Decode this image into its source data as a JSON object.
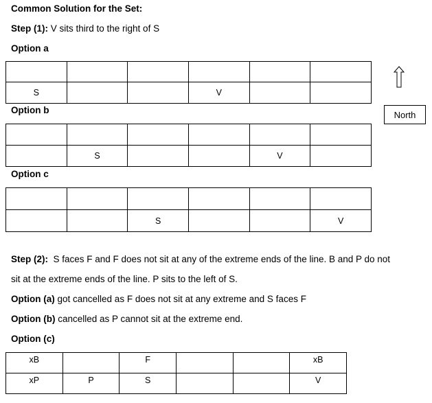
{
  "heading": "Common Solution for the Set:",
  "step1": {
    "label": "Step (1):",
    "text": " V sits third to the right of S"
  },
  "option_a": {
    "label": "Option a",
    "rows": [
      [
        "",
        "",
        "",
        "",
        "",
        ""
      ],
      [
        "S",
        "",
        "",
        "V",
        "",
        ""
      ]
    ]
  },
  "option_b": {
    "label": "Option b",
    "rows": [
      [
        "",
        "",
        "",
        "",
        "",
        ""
      ],
      [
        "",
        "S",
        "",
        "",
        "V",
        ""
      ]
    ]
  },
  "option_c": {
    "label": "Option c",
    "rows": [
      [
        "",
        "",
        "",
        "",
        "",
        ""
      ],
      [
        "",
        "",
        "S",
        "",
        "",
        "V"
      ]
    ]
  },
  "compass": {
    "icon": "up-arrow-icon",
    "label": "North"
  },
  "step2": {
    "label": "Step (2):",
    "line1": "  S faces F and F does not sit at any of the extreme ends of the line. B and P do not",
    "line2": "sit at the extreme ends of the line. P sits to the left of S."
  },
  "note_a": {
    "label": "Option (a)",
    "text": " got cancelled as F does not sit at any extreme and S faces F"
  },
  "note_b": {
    "label": "Option (b)",
    "text": " cancelled as P cannot sit at the extreme end."
  },
  "note_c": {
    "label": "Option (c)"
  },
  "final_table": {
    "rows": [
      [
        "xB",
        "",
        "F",
        "",
        "",
        "xB"
      ],
      [
        "xP",
        "P",
        "S",
        "",
        "",
        "V"
      ]
    ]
  }
}
